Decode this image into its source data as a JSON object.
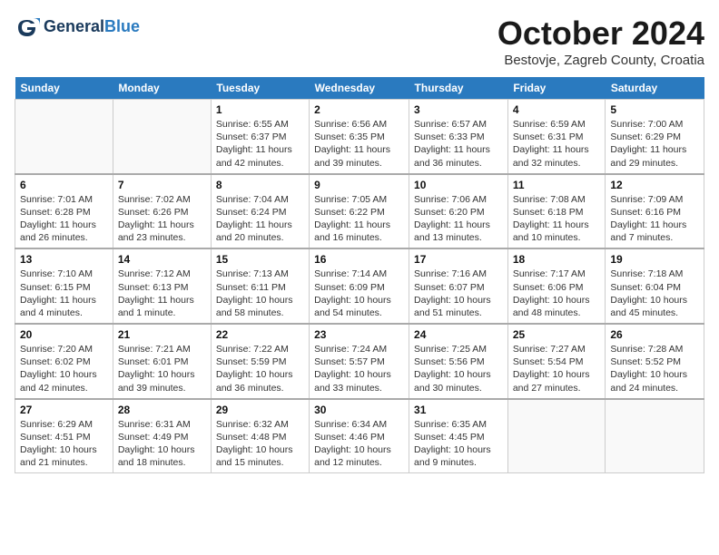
{
  "header": {
    "logo_line1": "General",
    "logo_line2": "Blue",
    "month": "October 2024",
    "location": "Bestovje, Zagreb County, Croatia"
  },
  "days_of_week": [
    "Sunday",
    "Monday",
    "Tuesday",
    "Wednesday",
    "Thursday",
    "Friday",
    "Saturday"
  ],
  "weeks": [
    [
      {
        "day": "",
        "info": ""
      },
      {
        "day": "",
        "info": ""
      },
      {
        "day": "1",
        "info": "Sunrise: 6:55 AM\nSunset: 6:37 PM\nDaylight: 11 hours and 42 minutes."
      },
      {
        "day": "2",
        "info": "Sunrise: 6:56 AM\nSunset: 6:35 PM\nDaylight: 11 hours and 39 minutes."
      },
      {
        "day": "3",
        "info": "Sunrise: 6:57 AM\nSunset: 6:33 PM\nDaylight: 11 hours and 36 minutes."
      },
      {
        "day": "4",
        "info": "Sunrise: 6:59 AM\nSunset: 6:31 PM\nDaylight: 11 hours and 32 minutes."
      },
      {
        "day": "5",
        "info": "Sunrise: 7:00 AM\nSunset: 6:29 PM\nDaylight: 11 hours and 29 minutes."
      }
    ],
    [
      {
        "day": "6",
        "info": "Sunrise: 7:01 AM\nSunset: 6:28 PM\nDaylight: 11 hours and 26 minutes."
      },
      {
        "day": "7",
        "info": "Sunrise: 7:02 AM\nSunset: 6:26 PM\nDaylight: 11 hours and 23 minutes."
      },
      {
        "day": "8",
        "info": "Sunrise: 7:04 AM\nSunset: 6:24 PM\nDaylight: 11 hours and 20 minutes."
      },
      {
        "day": "9",
        "info": "Sunrise: 7:05 AM\nSunset: 6:22 PM\nDaylight: 11 hours and 16 minutes."
      },
      {
        "day": "10",
        "info": "Sunrise: 7:06 AM\nSunset: 6:20 PM\nDaylight: 11 hours and 13 minutes."
      },
      {
        "day": "11",
        "info": "Sunrise: 7:08 AM\nSunset: 6:18 PM\nDaylight: 11 hours and 10 minutes."
      },
      {
        "day": "12",
        "info": "Sunrise: 7:09 AM\nSunset: 6:16 PM\nDaylight: 11 hours and 7 minutes."
      }
    ],
    [
      {
        "day": "13",
        "info": "Sunrise: 7:10 AM\nSunset: 6:15 PM\nDaylight: 11 hours and 4 minutes."
      },
      {
        "day": "14",
        "info": "Sunrise: 7:12 AM\nSunset: 6:13 PM\nDaylight: 11 hours and 1 minute."
      },
      {
        "day": "15",
        "info": "Sunrise: 7:13 AM\nSunset: 6:11 PM\nDaylight: 10 hours and 58 minutes."
      },
      {
        "day": "16",
        "info": "Sunrise: 7:14 AM\nSunset: 6:09 PM\nDaylight: 10 hours and 54 minutes."
      },
      {
        "day": "17",
        "info": "Sunrise: 7:16 AM\nSunset: 6:07 PM\nDaylight: 10 hours and 51 minutes."
      },
      {
        "day": "18",
        "info": "Sunrise: 7:17 AM\nSunset: 6:06 PM\nDaylight: 10 hours and 48 minutes."
      },
      {
        "day": "19",
        "info": "Sunrise: 7:18 AM\nSunset: 6:04 PM\nDaylight: 10 hours and 45 minutes."
      }
    ],
    [
      {
        "day": "20",
        "info": "Sunrise: 7:20 AM\nSunset: 6:02 PM\nDaylight: 10 hours and 42 minutes."
      },
      {
        "day": "21",
        "info": "Sunrise: 7:21 AM\nSunset: 6:01 PM\nDaylight: 10 hours and 39 minutes."
      },
      {
        "day": "22",
        "info": "Sunrise: 7:22 AM\nSunset: 5:59 PM\nDaylight: 10 hours and 36 minutes."
      },
      {
        "day": "23",
        "info": "Sunrise: 7:24 AM\nSunset: 5:57 PM\nDaylight: 10 hours and 33 minutes."
      },
      {
        "day": "24",
        "info": "Sunrise: 7:25 AM\nSunset: 5:56 PM\nDaylight: 10 hours and 30 minutes."
      },
      {
        "day": "25",
        "info": "Sunrise: 7:27 AM\nSunset: 5:54 PM\nDaylight: 10 hours and 27 minutes."
      },
      {
        "day": "26",
        "info": "Sunrise: 7:28 AM\nSunset: 5:52 PM\nDaylight: 10 hours and 24 minutes."
      }
    ],
    [
      {
        "day": "27",
        "info": "Sunrise: 6:29 AM\nSunset: 4:51 PM\nDaylight: 10 hours and 21 minutes."
      },
      {
        "day": "28",
        "info": "Sunrise: 6:31 AM\nSunset: 4:49 PM\nDaylight: 10 hours and 18 minutes."
      },
      {
        "day": "29",
        "info": "Sunrise: 6:32 AM\nSunset: 4:48 PM\nDaylight: 10 hours and 15 minutes."
      },
      {
        "day": "30",
        "info": "Sunrise: 6:34 AM\nSunset: 4:46 PM\nDaylight: 10 hours and 12 minutes."
      },
      {
        "day": "31",
        "info": "Sunrise: 6:35 AM\nSunset: 4:45 PM\nDaylight: 10 hours and 9 minutes."
      },
      {
        "day": "",
        "info": ""
      },
      {
        "day": "",
        "info": ""
      }
    ]
  ]
}
